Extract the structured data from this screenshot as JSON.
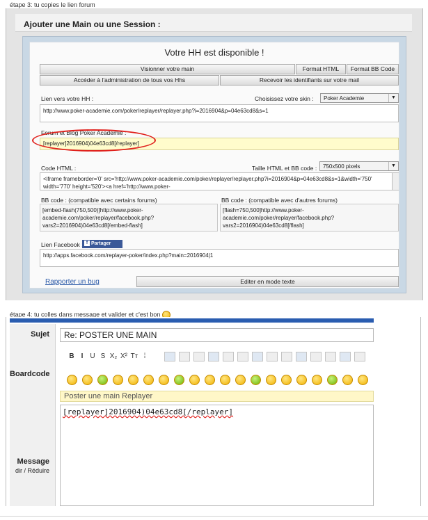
{
  "step3": "étape 3: tu copies le lien forum",
  "replayer_panel": {
    "header": "Ajouter une Main ou une Session :",
    "title": "Votre HH est disponible !",
    "btn_view": "Visionner votre main",
    "btn_html": "Format HTML",
    "btn_bb": "Format BB Code",
    "btn_admin": "Accéder à l'administration de tous vos Hhs",
    "btn_ident": "Recevoir les identifiants sur votre mail",
    "link_label": "Lien vers votre HH :",
    "skin_label": "Choisissez votre skin :",
    "skin_value": "Poker Academie",
    "link_value": "http://www.poker-academie.com/poker/replayer/replayer.php?i=2016904&p=04e63cd8&s=1",
    "forum_label": "Forum et Blog Poker Academie :",
    "forum_value": "[replayer]2016904)04e63cd8[/replayer]",
    "html_label": "Code HTML :",
    "size_label": "Taille HTML et BB code :",
    "size_value": "750x500 pixels",
    "html_value": "<iframe frameborder='0' src='http://www.poker-academie.com/poker/replayer/replayer.php?i=2016904&p=04e63cd8&s=1&width='750' width='770' height='520'><a href='http://www.poker-",
    "bb1_label": "BB code : (compatible avec certains forums)",
    "bb1_value": "[embed-flash(750,500)]http://www.poker-academie.com/poker/replayer/facebook.php?vars2=2016904)04e63cd8[/embed-flash]",
    "bb2_label": "BB code : (compatible avec d'autres forums)",
    "bb2_value": "[flash=750,500]http://www.poker-academie.com/poker/replayer/facebook.php?vars2=2016904)04e63cd8[/flash]",
    "fb_label": "Lien Facebook :",
    "fb_btn": "Partager",
    "fb_value": "http://apps.facebook.com/replayer-poker/index.php?main=2016904|1",
    "report": "Rapporter un bug",
    "edit_btn": "Editer en mode texte"
  },
  "step4": "étape 4: tu colles dans message et valider et c'est bon",
  "post_form": {
    "subject_label": "Sujet",
    "subject_value": "Re: POSTER UNE MAIN",
    "boardcode_label": "Boardcode",
    "toolbar_buttons": [
      "B",
      "I",
      "U",
      "S",
      "X₂",
      "X²",
      "Tт",
      "⁞"
    ],
    "replayer_line": "Poster une main Replayer",
    "message_label": "Message",
    "message_sub": "dir /  Réduire",
    "message_value": "[replayer]2016904)04e63cd8[/replayer]"
  }
}
